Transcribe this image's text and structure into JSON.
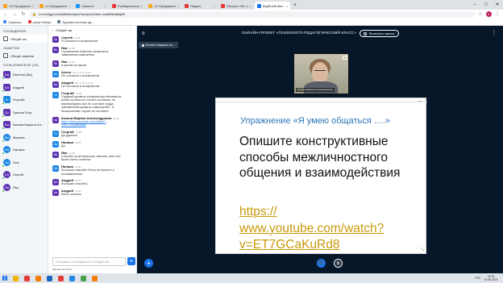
{
  "browser": {
    "tabs": [
      {
        "label": "1С:Предприятие",
        "color": "#f5a623",
        "active": false
      },
      {
        "label": "1С:Предприятие",
        "color": "#f5a623",
        "active": false
      },
      {
        "label": "Новости",
        "color": "#2196f3",
        "active": false
      },
      {
        "label": "Разбирательство, поиск",
        "color": "#e53935",
        "active": false
      },
      {
        "label": "1С:Предприятие",
        "color": "#f5a623",
        "active": false
      },
      {
        "label": "Яндекс",
        "color": "#e53935",
        "active": false
      },
      {
        "label": "Письмо «Re: занятие Стр...",
        "color": "#e53935",
        "active": false
      },
      {
        "label": "BigBlueButton - Онл...",
        "color": "#1a73e8",
        "active": true
      }
    ],
    "url": "vr.mordgpi.ru/html5client/join?sessionToken=xsdd5sbt8stpff1",
    "bookmarks": [
      {
        "label": "Сервисы",
        "color": "#4285f4"
      },
      {
        "label": "pdoyf Infolep",
        "color": "#e53935"
      },
      {
        "label": "Единая система ид...",
        "color": "#607d8b"
      }
    ],
    "profile_initial": "K"
  },
  "sidebar": {
    "messages_header": "СООБЩЕНИЯ",
    "public_chat": "Общий чат",
    "notes_header": "ЗАМЕТКИ",
    "shared_notes": "Общие заметки",
    "users_header": "ПОЛЬЗОВАТЕЛИ (18)",
    "users": [
      {
        "initials": "Ев",
        "name": "Евгения (Вы)",
        "color": "#5e35b1",
        "round": false
      },
      {
        "initials": "Ан",
        "name": "Андрей",
        "color": "#5e35b1",
        "round": false
      },
      {
        "initials": "Ге",
        "name": "Георгий",
        "color": "#1e88e5",
        "round": false
      },
      {
        "initials": "Гр",
        "name": "Гришин Егор",
        "color": "#5e35b1",
        "round": false
      },
      {
        "initials": "Ка",
        "name": "Качина Марина Ал...",
        "color": "#5e35b1",
        "round": false
      },
      {
        "initials": "Ма",
        "name": "Марина",
        "color": "#1e88e5",
        "round": true
      },
      {
        "initials": "На",
        "name": "Наташа",
        "color": "#1e88e5",
        "round": true
      },
      {
        "initials": "Ол",
        "name": "Оля",
        "color": "#1e88e5",
        "round": true
      },
      {
        "initials": "Се",
        "name": "Сергей",
        "color": "#5e35b1",
        "round": true
      },
      {
        "initials": "Ян",
        "name": "Яна",
        "color": "#5e35b1",
        "round": true
      }
    ]
  },
  "chat": {
    "title": "Общий чат",
    "messages": [
      {
        "initials": "Се",
        "color": "#5e35b1",
        "name": "Сергей",
        "time": "11:29",
        "lines": [
          "Я согласен в конфликтом"
        ],
        "link": false
      },
      {
        "initials": "Ян",
        "color": "#5e35b1",
        "name": "Яна",
        "time": "11:30",
        "lines": [
          "Стремление избегать конфликта,",
          "замкнанная самоценка"
        ],
        "link": false
      },
      {
        "initials": "Ян",
        "color": "#5e35b1",
        "name": "Яна",
        "time": "11:31",
        "lines": [
          "в целом согласна"
        ],
        "link": false
      },
      {
        "initials": "Ал",
        "color": "#1e88e5",
        "name": "Алеся",
        "time": "Нет в сети 11:33",
        "lines": [
          "Не согласна с конфликтом"
        ],
        "link": false
      },
      {
        "initials": "Ан",
        "color": "#5e35b1",
        "name": "Андрей",
        "time": "Нет в сети 11:34",
        "lines": [
          "Не согласна в конфликтом"
        ],
        "link": false
      },
      {
        "initials": "Ге",
        "color": "#1e88e5",
        "name": "Георгий",
        "time": "11:38",
        "lines": [
          "Средний уровень конфликтоустойчивости,",
          "робка пытаетесь столкть на своем, но",
          "перевубедить вас не составит труда.",
          "Заниженный уровень самооценки - в",
          "большинстве случае не согласен"
        ],
        "link": false
      },
      {
        "initials": "Ка",
        "color": "#5e35b1",
        "name": "Качина Марина Александровна",
        "time": "11:45",
        "lines": [
          "https://www.youtube.com/watch?",
          "v=ET7GCaKuRd8"
        ],
        "link": true
      },
      {
        "initials": "Ге",
        "color": "#1e88e5",
        "name": "Георгий",
        "time": "11:48",
        "lines": [
          "Да удалось"
        ],
        "link": false
      },
      {
        "initials": "На",
        "color": "#1e88e5",
        "name": "Наташа",
        "time": "11:48",
        "lines": [
          "Да"
        ],
        "link": false
      },
      {
        "initials": "Ян",
        "color": "#5e35b1",
        "name": "Яна",
        "time": "11:48",
        "lines": [
          "Спасибо за интересные занятия, мне они",
          "были очень полезны"
        ],
        "link": false
      },
      {
        "initials": "На",
        "color": "#1e88e5",
        "name": "Наташа",
        "time": "11:50",
        "lines": [
          "Большое спасибо! Было интересно и",
          "познавательно"
        ],
        "link": false
      },
      {
        "initials": "Ан",
        "color": "#5e35b1",
        "name": "Андрей",
        "time": "11:50",
        "lines": [
          "Большое спасибо)"
        ],
        "link": false
      },
      {
        "initials": "Ан",
        "color": "#5e35b1",
        "name": "Андрей",
        "time": "11:50",
        "lines": [
          "Было полезно"
        ],
        "link": false
      }
    ],
    "input_placeholder": "Отправить сообщение в Общий чат",
    "typing": "Марина печатает"
  },
  "meeting": {
    "title": "ОНЛАЙН-ПРОЕКТ «ПСИХОЛОГО-ПЕДАГОГИЧЕСКИЙ КЛАСС»",
    "record_label": "Включить запись",
    "presenter": "Кочина Марина Ал...",
    "webcam_name": "Кочина Марина Александровна"
  },
  "slide": {
    "heading": "Упражнение «Я умею общаться ….»",
    "body": "Опишите конструктивные способы межличностного общения и взаимодействия",
    "link": "https:// www.youtube.com/watch?v=ET7GCaKuRd8"
  },
  "taskbar": {
    "icons": [
      "#f4b400",
      "#e53935",
      "#f57c00",
      "#1565c0",
      "#e53935",
      "#1e88e5",
      "#43a047",
      "#f57c00"
    ],
    "lang": "РУС",
    "time": "11:51",
    "date": "10.06.2021"
  }
}
